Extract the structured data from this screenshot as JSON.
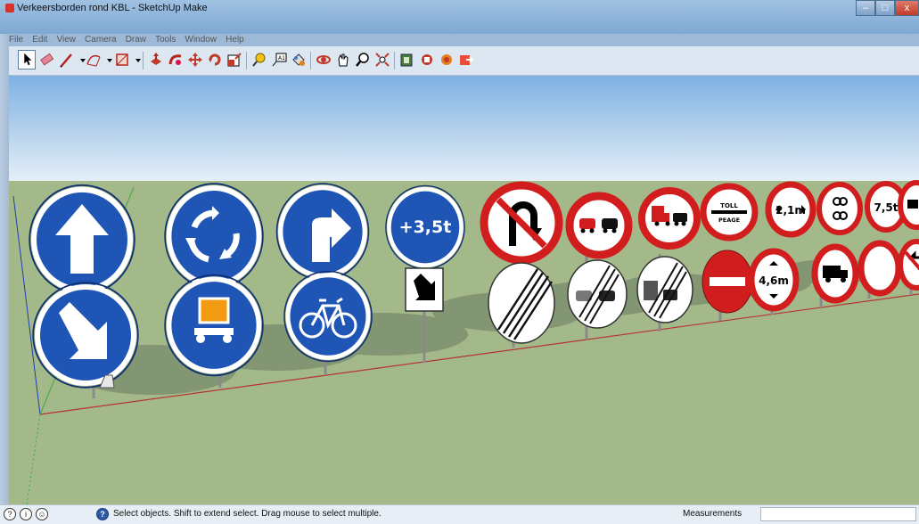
{
  "window": {
    "title": "Verkeersborden rond KBL - SketchUp Make",
    "minimize": "–",
    "maximize": "□",
    "close": "x"
  },
  "menu": [
    "File",
    "Edit",
    "View",
    "Camera",
    "Draw",
    "Tools",
    "Window",
    "Help"
  ],
  "toolbar": {
    "tools": [
      "select-icon",
      "eraser-icon",
      "pencil-line-icon",
      "dropdown-arrow-icon",
      "arc-icon",
      "dropdown-arrow-icon",
      "rectangle-icon",
      "dropdown-arrow-icon",
      "push-pull-icon",
      "follow-me-icon",
      "move-icon",
      "rotate-icon",
      "scale-icon",
      "tape-measure-icon",
      "text-icon",
      "paint-bucket-icon",
      "orbit-icon",
      "pan-icon",
      "zoom-icon",
      "zoom-extents-icon",
      "warehouse-icon",
      "extension-icon",
      "components-icon",
      "share-model-icon"
    ]
  },
  "signs": {
    "plus_weight": "+3,5t",
    "toll_top": "TOLL",
    "toll_bottom": "PEAGE",
    "height_limit": "4,6m",
    "width_limit": "2,1m",
    "weight_limit": "7,5t"
  },
  "status": {
    "hint": "Select objects. Shift to extend select. Drag mouse to select multiple.",
    "measurements_label": "Measurements",
    "measurements_value": ""
  },
  "colors": {
    "sky_top": "#84b3e0",
    "sky_bottom": "#e4eef6",
    "ground": "#a4b98a",
    "blue_sign": "#1f55b5",
    "red_ring": "#d11d1d"
  }
}
